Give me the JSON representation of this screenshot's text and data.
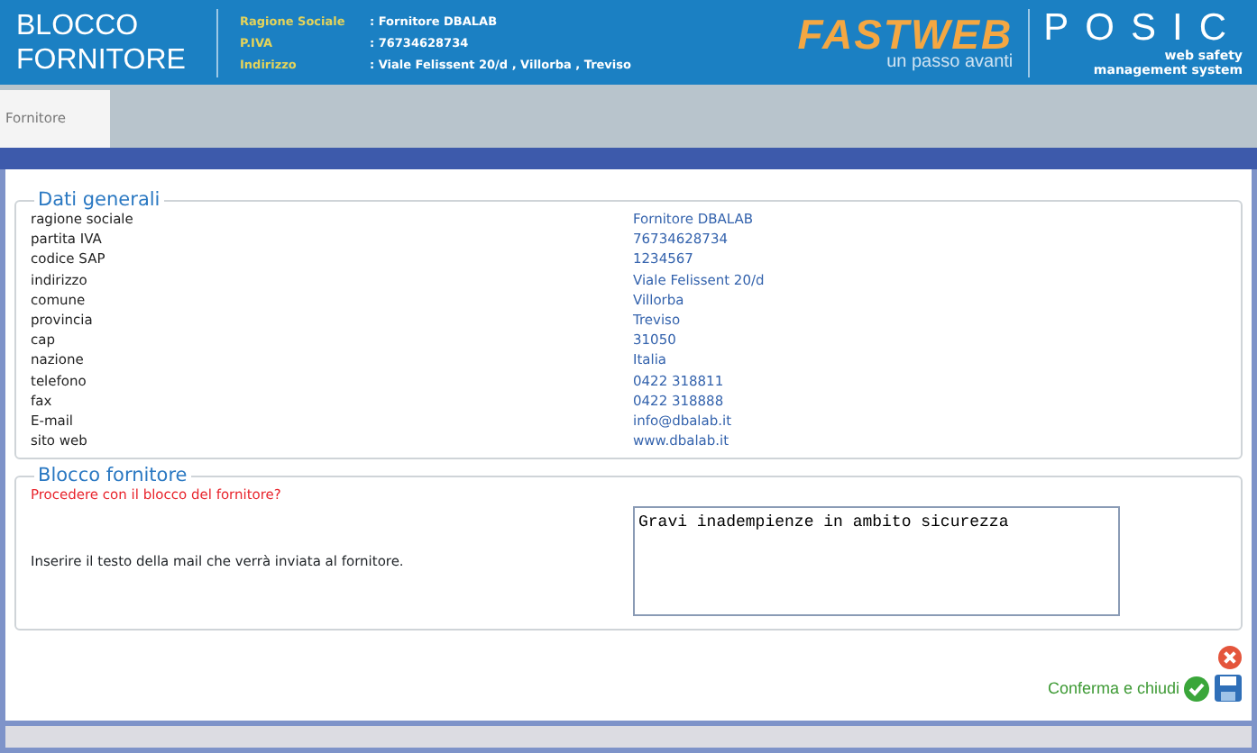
{
  "header": {
    "title": "BLOCCO FORNITORE",
    "info": [
      {
        "label": "Ragione Sociale",
        "value": ": Fornitore DBALAB"
      },
      {
        "label": "P.IVA",
        "value": ": 76734628734"
      },
      {
        "label": "Indirizzo",
        "value": ": Viale Felissent 20/d , Villorba , Treviso"
      }
    ],
    "brand": {
      "name": "FASTWEB",
      "tagline": "un passo avanti"
    },
    "product": {
      "name": "POSIC",
      "subtitle": [
        "web safety",
        "management system"
      ]
    }
  },
  "tabs": [
    {
      "label": "Fornitore",
      "selected": true
    }
  ],
  "general": {
    "legend": "Dati generali",
    "rows": [
      {
        "label": "ragione sociale",
        "value": "Fornitore DBALAB"
      },
      {
        "label": "partita IVA",
        "value": "76734628734"
      },
      {
        "label": "codice SAP",
        "value": "1234567"
      },
      {
        "label": "indirizzo",
        "value": "Viale Felissent 20/d"
      },
      {
        "label": "comune",
        "value": "Villorba"
      },
      {
        "label": "provincia",
        "value": "Treviso"
      },
      {
        "label": "cap",
        "value": "31050"
      },
      {
        "label": "nazione",
        "value": "Italia"
      },
      {
        "label": "telefono",
        "value": "0422 318811"
      },
      {
        "label": "fax",
        "value": "0422 318888"
      },
      {
        "label": "E-mail",
        "value": "info@dbalab.it"
      },
      {
        "label": "sito web",
        "value": "www.dbalab.it"
      }
    ]
  },
  "block": {
    "legend": "Blocco fornitore",
    "question": "Procedere con il blocco del fornitore?",
    "prompt": "Inserire il testo della mail che verrà inviata al fornitore.",
    "mail_text": "Gravi inadempienze in ambito sicurezza"
  },
  "actions": {
    "confirm": "Conferma e chiudi"
  }
}
